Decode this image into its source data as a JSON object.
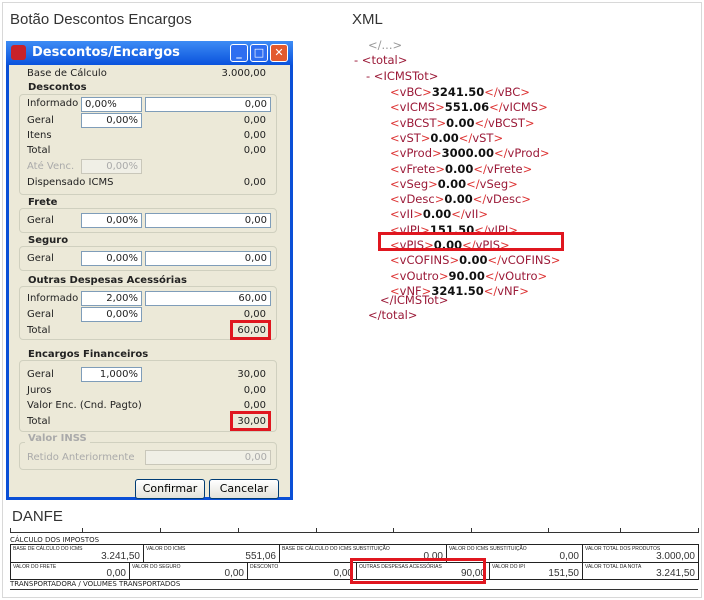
{
  "headings": {
    "left": "Botão Descontos Encargos",
    "right": "XML",
    "bottom": "DANFE"
  },
  "dialog": {
    "title": "Descontos/Encargos",
    "base_label": "Base de Cálculo",
    "base_value": "3.000,00",
    "descontos": {
      "title": "Descontos",
      "informado_label": "Informado",
      "informado_pct": "0,00%",
      "informado_value": "0,00",
      "geral_label": "Geral",
      "geral_pct": "0,00%",
      "geral_value": "0,00",
      "itens_label": "Itens",
      "itens_value": "0,00",
      "total_label": "Total",
      "total_value": "0,00",
      "ate_label": "Até Venc.",
      "ate_pct": "0,00%",
      "dispensado_label": "Dispensado ICMS",
      "dispensado_value": "0,00"
    },
    "frete": {
      "title": "Frete",
      "geral_label": "Geral",
      "geral_pct": "0,00%",
      "geral_value": "0,00"
    },
    "seguro": {
      "title": "Seguro",
      "geral_label": "Geral",
      "geral_pct": "0,00%",
      "geral_value": "0,00"
    },
    "outras": {
      "title": "Outras Despesas Acessórias",
      "informado_label": "Informado",
      "informado_pct": "2,00%",
      "informado_value": "60,00",
      "geral_label": "Geral",
      "geral_pct": "0,00%",
      "geral_value": "0,00",
      "total_label": "Total",
      "total_value": "60,00"
    },
    "encargos": {
      "title": "Encargos Financeiros",
      "geral_label": "Geral",
      "geral_pct": "1,000%",
      "geral_value": "30,00",
      "juros_label": "Juros",
      "juros_value": "0,00",
      "valor_label": "Valor Enc. (Cnd. Pagto)",
      "valor_value": "0,00",
      "total_label": "Total",
      "total_value": "30,00"
    },
    "inss": {
      "title": "Valor INSS",
      "retido_label": "Retido Anteriormente",
      "retido_value": "0,00"
    },
    "confirm": "Confirmar",
    "cancel": "Cancelar"
  },
  "xml": {
    "lines": [
      {
        "tag": "vBC",
        "value": "3241.50"
      },
      {
        "tag": "vICMS",
        "value": "551.06"
      },
      {
        "tag": "vBCST",
        "value": "0.00"
      },
      {
        "tag": "vST",
        "value": "0.00"
      },
      {
        "tag": "vProd",
        "value": "3000.00"
      },
      {
        "tag": "vFrete",
        "value": "0.00"
      },
      {
        "tag": "vSeg",
        "value": "0.00"
      },
      {
        "tag": "vDesc",
        "value": "0.00"
      },
      {
        "tag": "vII",
        "value": "0.00"
      },
      {
        "tag": "vIPI",
        "value": "151.50"
      },
      {
        "tag": "vPIS",
        "value": "0.00"
      },
      {
        "tag": "vCOFINS",
        "value": "0.00"
      },
      {
        "tag": "vOutro",
        "value": "90.00"
      },
      {
        "tag": "vNF",
        "value": "3241.50"
      }
    ],
    "total_open": "- <total>",
    "icms_open": "- <ICMSTot>",
    "icms_close": "</ICMSTot>",
    "total_close": "</total>"
  },
  "danfe": {
    "section1": "CÁLCULO DOS IMPOSTOS",
    "row1": [
      {
        "label": "BASE DE CÁLCULO DO ICMS",
        "value": "3.241,50"
      },
      {
        "label": "VALOR DO ICMS",
        "value": "551,06"
      },
      {
        "label": "BASE DE CÁLCULO DO ICMS SUBSTITUIÇÃO",
        "value": "0,00"
      },
      {
        "label": "VALOR DO ICMS SUBSTITUIÇÃO",
        "value": "0,00"
      },
      {
        "label": "VALOR TOTAL DOS PRODUTOS",
        "value": "3.000,00"
      }
    ],
    "row2": [
      {
        "label": "VALOR DO FRETE",
        "value": "0,00"
      },
      {
        "label": "VALOR DO SEGURO",
        "value": "0,00"
      },
      {
        "label": "DESCONTO",
        "value": "0,00"
      },
      {
        "label": "OUTRAS DESPESAS ACESSÓRIAS",
        "value": "90,00"
      },
      {
        "label": "VALOR DO IPI",
        "value": "151,50"
      },
      {
        "label": "VALOR TOTAL DA NOTA",
        "value": "3.241,50"
      }
    ],
    "section2": "TRANSPORTADORA / VOLUMES TRANSPORTADOS"
  },
  "colors": {
    "highlight": "#e0161f",
    "titlebar": "#0a52dd"
  }
}
